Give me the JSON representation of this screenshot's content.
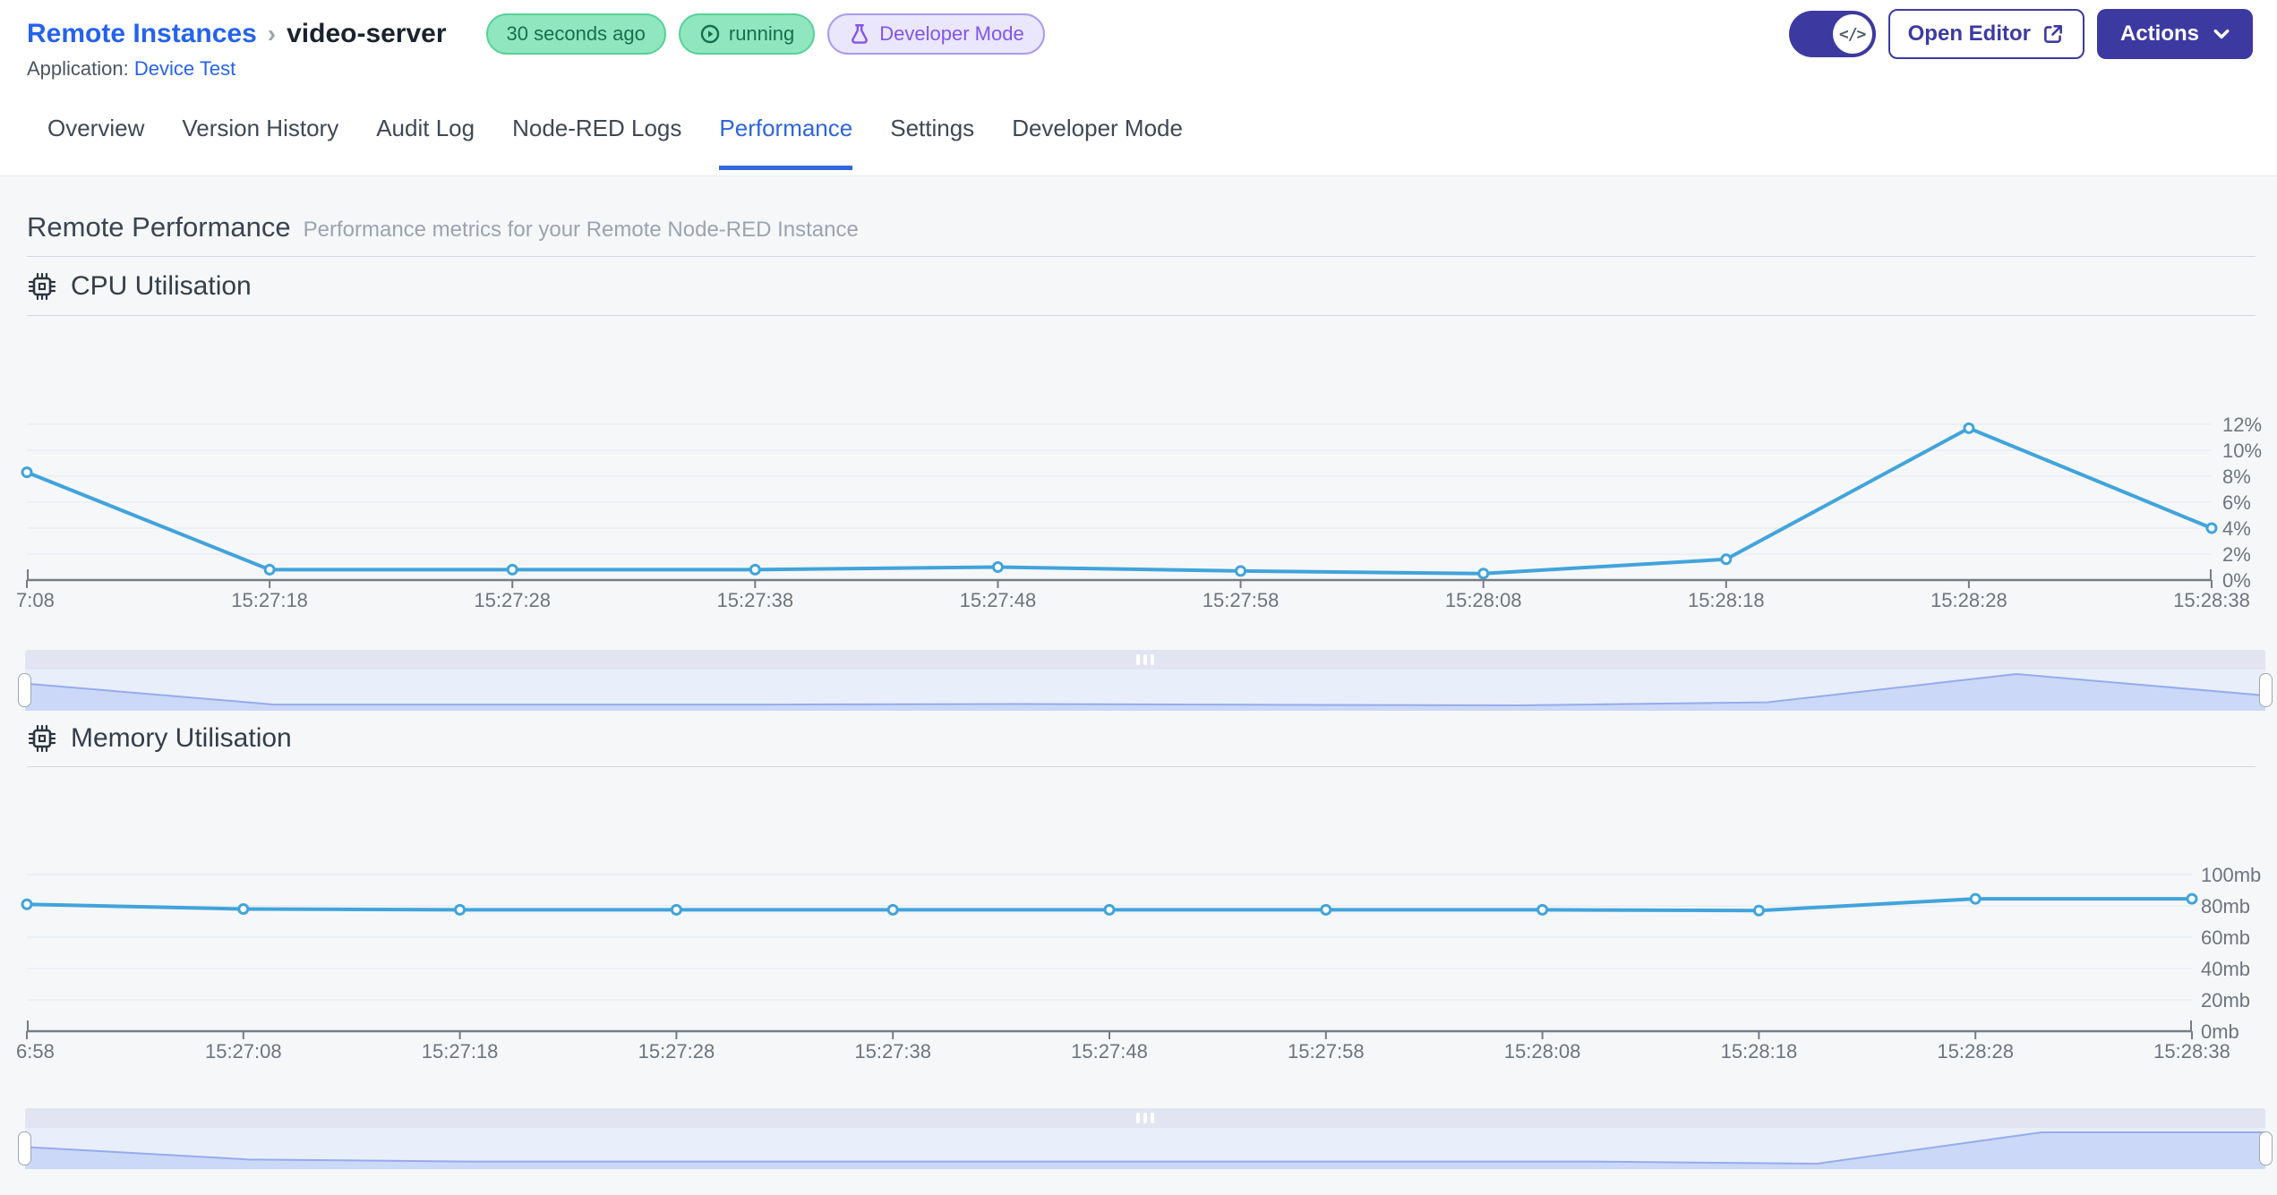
{
  "header": {
    "breadcrumb": {
      "parent": "Remote Instances",
      "separator": "›",
      "current": "video-server"
    },
    "badges": {
      "last_seen": "30 seconds ago",
      "status": "running",
      "mode": "Developer Mode"
    },
    "application_label": "Application:",
    "application_name": "Device Test",
    "actions": {
      "toggle_icon": "</>",
      "open_editor": "Open Editor",
      "actions_label": "Actions"
    }
  },
  "tabs": [
    "Overview",
    "Version History",
    "Audit Log",
    "Node-RED Logs",
    "Performance",
    "Settings",
    "Developer Mode"
  ],
  "active_tab": "Performance",
  "page": {
    "title": "Remote Performance",
    "subtitle": "Performance metrics for your Remote Node-RED Instance"
  },
  "colors": {
    "accent_indigo": "#3C3AA0",
    "link_blue": "#2563EB",
    "active_tab_blue": "#2E65DB",
    "badge_green_bg": "#90E7BF",
    "badge_green_text": "#156F4B",
    "badge_purple_bg": "#EAE7FC",
    "badge_purple_text": "#8156E9",
    "chart_line": "#41A4DB",
    "grid": "#E8EDF3",
    "axis": "#767C87",
    "axis_label": "#6E747E",
    "brush_fill": "#CBD8F7",
    "brush_line": "#95ACEC",
    "brush_bg": "#E9EEFB",
    "brush_move_handle": "#E2E5F1"
  },
  "chart_data": [
    {
      "id": "cpu",
      "type": "line",
      "title": "CPU Utilisation",
      "x_labels": [
        "7:08",
        "15:27:18",
        "15:27:28",
        "15:27:38",
        "15:27:48",
        "15:27:58",
        "15:28:08",
        "15:28:18",
        "15:28:28",
        "15:28:38"
      ],
      "values": [
        8.3,
        0.8,
        0.8,
        0.8,
        1.0,
        0.7,
        0.5,
        1.6,
        11.7,
        4.0
      ],
      "y_ticks": [
        "0%",
        "2%",
        "4%",
        "6%",
        "8%",
        "10%",
        "12%"
      ],
      "y_tick_values": [
        0,
        2,
        4,
        6,
        8,
        10,
        12
      ],
      "ylim": [
        0,
        12
      ],
      "legend": "none",
      "grid": "on"
    },
    {
      "id": "memory",
      "type": "line",
      "title": "Memory Utilisation",
      "x_labels": [
        "6:58",
        "15:27:08",
        "15:27:18",
        "15:27:28",
        "15:27:38",
        "15:27:48",
        "15:27:58",
        "15:28:08",
        "15:28:18",
        "15:28:28",
        "15:28:38"
      ],
      "values": [
        81,
        78,
        77.5,
        77.5,
        77.5,
        77.5,
        77.5,
        77.5,
        77,
        84.5,
        84.5
      ],
      "y_ticks": [
        "0mb",
        "20mb",
        "40mb",
        "60mb",
        "80mb",
        "100mb"
      ],
      "y_tick_values": [
        0,
        20,
        40,
        60,
        80,
        100
      ],
      "ylim": [
        0,
        100
      ],
      "legend": "none",
      "grid": "on"
    }
  ]
}
